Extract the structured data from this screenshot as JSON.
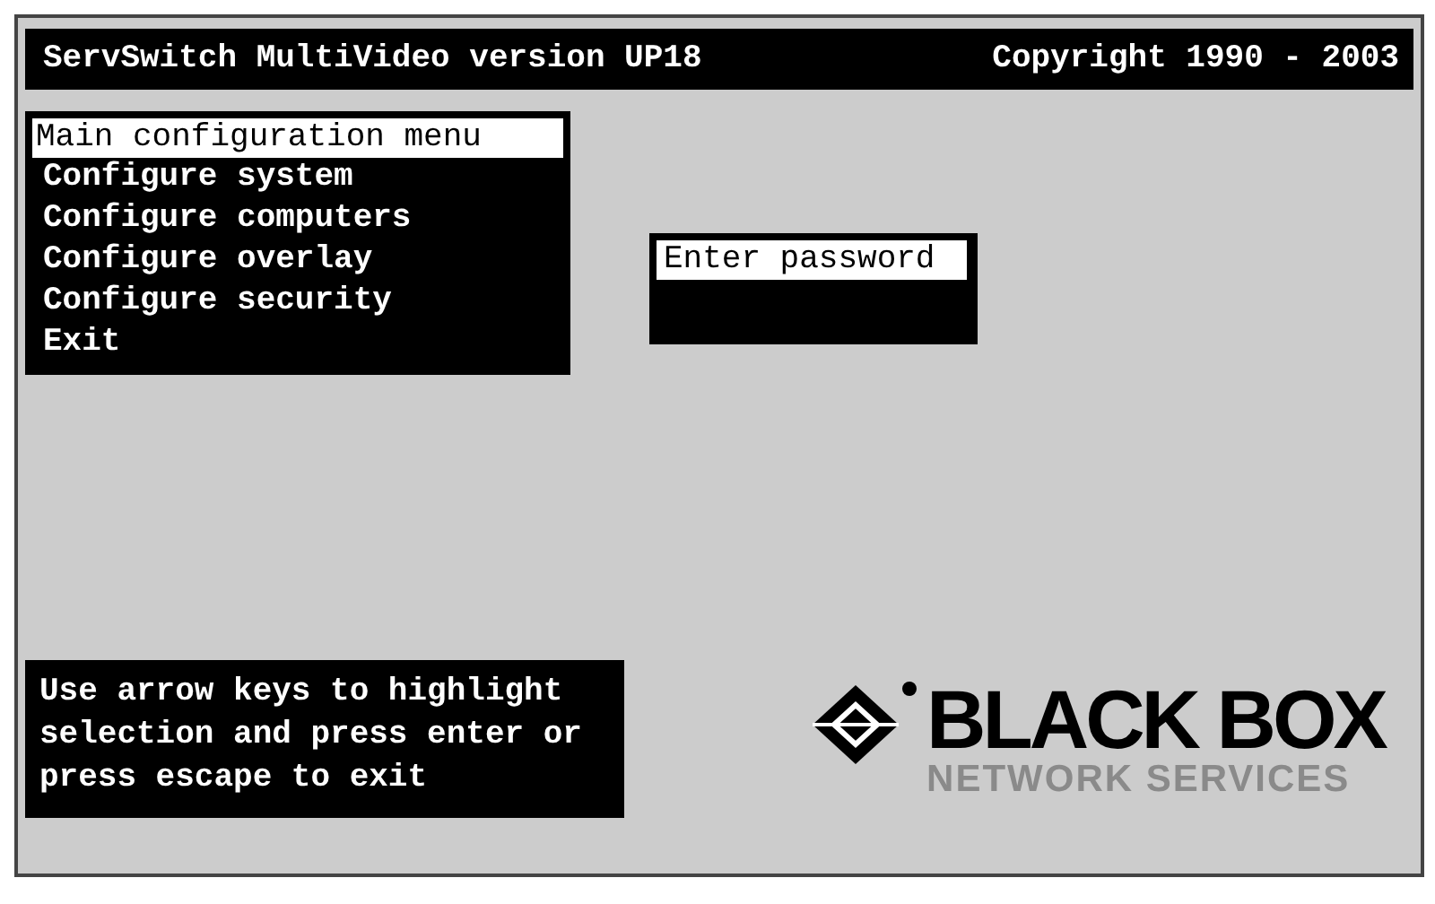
{
  "title_bar": {
    "title": "ServSwitch MultiVideo version UP18",
    "copyright": "Copyright 1990 - 2003"
  },
  "menu": {
    "title": "Main configuration menu",
    "items": [
      {
        "label": "Configure system"
      },
      {
        "label": "Configure computers"
      },
      {
        "label": "Configure overlay"
      },
      {
        "label": "Configure security"
      },
      {
        "label": "Exit"
      }
    ]
  },
  "password_dialog": {
    "title": "Enter password"
  },
  "help_text": "Use arrow keys to highlight selection and press enter or press escape to exit",
  "logo": {
    "name": "BLACK BOX",
    "tagline": "NETWORK SERVICES"
  }
}
